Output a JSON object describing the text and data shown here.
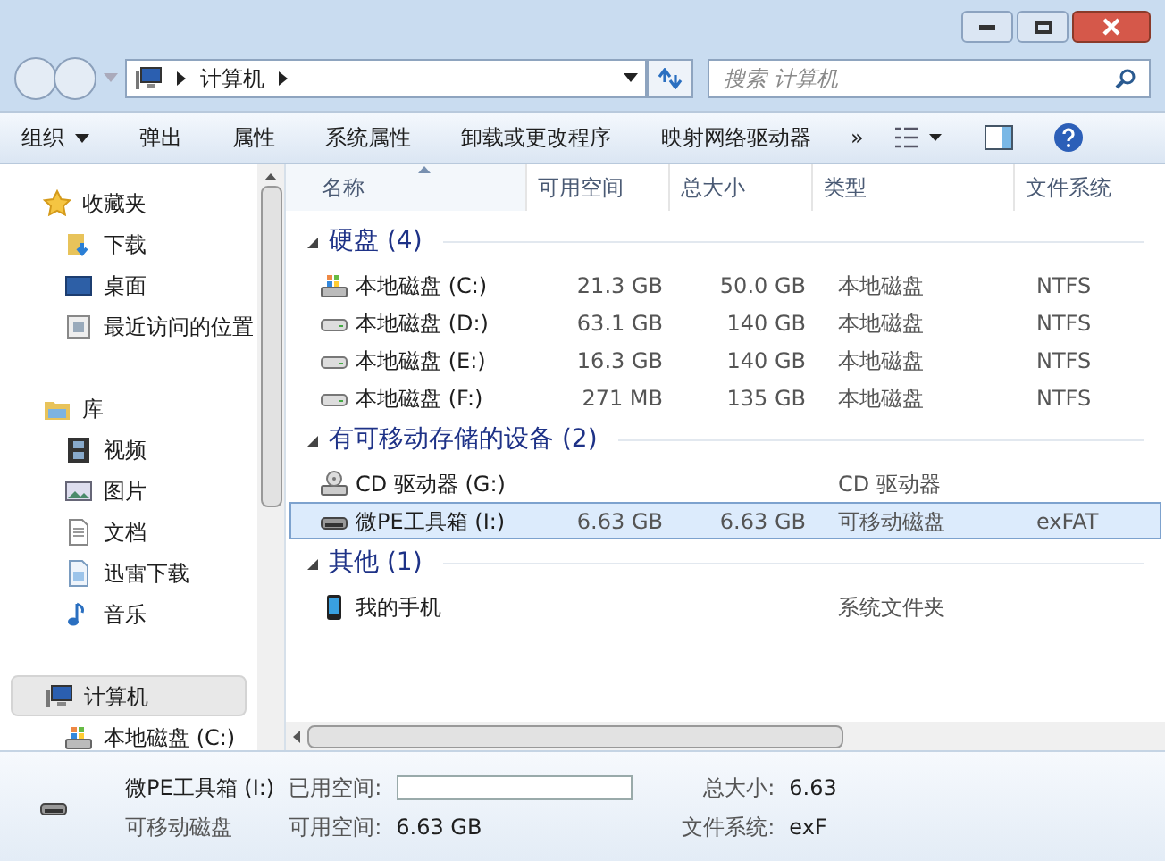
{
  "address_bar": {
    "path": [
      "计算机"
    ]
  },
  "search": {
    "placeholder": "搜索 计算机"
  },
  "toolbar": {
    "items": [
      {
        "label": "组织",
        "dropdown": true
      },
      {
        "label": "弹出",
        "dropdown": false
      },
      {
        "label": "属性",
        "dropdown": false
      },
      {
        "label": "系统属性",
        "dropdown": false
      },
      {
        "label": "卸载或更改程序",
        "dropdown": false
      },
      {
        "label": "映射网络驱动器",
        "dropdown": false
      }
    ],
    "overflow": "»"
  },
  "nav": [
    {
      "label": "收藏夹",
      "kind": "star",
      "selected": false,
      "children": [
        {
          "label": "下载",
          "kind": "download",
          "selected": false
        },
        {
          "label": "桌面",
          "kind": "desktop",
          "selected": false
        },
        {
          "label": "最近访问的位置",
          "kind": "recent",
          "selected": false
        }
      ]
    },
    {
      "label": "库",
      "kind": "library",
      "selected": false,
      "children": [
        {
          "label": "视频",
          "kind": "video",
          "selected": false
        },
        {
          "label": "图片",
          "kind": "picture",
          "selected": false
        },
        {
          "label": "文档",
          "kind": "document",
          "selected": false
        },
        {
          "label": "迅雷下载",
          "kind": "document2",
          "selected": false
        },
        {
          "label": "音乐",
          "kind": "music",
          "selected": false
        }
      ]
    },
    {
      "label": "计算机",
      "kind": "computer",
      "selected": true,
      "children": [
        {
          "label": "本地磁盘 (C:)",
          "kind": "sysdrive",
          "selected": false
        }
      ]
    }
  ],
  "columns": [
    {
      "label": "名称",
      "sorted": true
    },
    {
      "label": "可用空间",
      "sorted": false
    },
    {
      "label": "总大小",
      "sorted": false
    },
    {
      "label": "类型",
      "sorted": false
    },
    {
      "label": "文件系统",
      "sorted": false
    }
  ],
  "groups": [
    {
      "title": "硬盘 (4)",
      "expanded": true,
      "items": [
        {
          "name": "本地磁盘 (C:)",
          "kind": "sysdrive",
          "free": "21.3 GB",
          "total": "50.0 GB",
          "type": "本地磁盘",
          "fs": "NTFS",
          "selected": false
        },
        {
          "name": "本地磁盘 (D:)",
          "kind": "drive",
          "free": "63.1 GB",
          "total": "140 GB",
          "type": "本地磁盘",
          "fs": "NTFS",
          "selected": false
        },
        {
          "name": "本地磁盘 (E:)",
          "kind": "drive",
          "free": "16.3 GB",
          "total": "140 GB",
          "type": "本地磁盘",
          "fs": "NTFS",
          "selected": false
        },
        {
          "name": "本地磁盘 (F:)",
          "kind": "drive",
          "free": "271 MB",
          "total": "135 GB",
          "type": "本地磁盘",
          "fs": "NTFS",
          "selected": false
        }
      ]
    },
    {
      "title": "有可移动存储的设备 (2)",
      "expanded": true,
      "items": [
        {
          "name": "CD 驱动器 (G:)",
          "kind": "cd",
          "type": "CD 驱动器",
          "selected": false
        },
        {
          "name": "微PE工具箱 (I:)",
          "kind": "usb",
          "free": "6.63 GB",
          "total": "6.63 GB",
          "type": "可移动磁盘",
          "fs": "exFAT",
          "selected": true
        }
      ]
    },
    {
      "title": "其他 (1)",
      "expanded": true,
      "items": [
        {
          "name": "我的手机",
          "kind": "phone",
          "type": "系统文件夹",
          "selected": false
        }
      ]
    }
  ],
  "details": {
    "name": "微PE工具箱 (I:)",
    "type": "可移动磁盘",
    "used_label": "已用空间:",
    "used_bar": {
      "level": 0
    },
    "free_label": "可用空间:",
    "free": "6.63 GB",
    "total_label": "总大小:",
    "total": "6.63",
    "fs_label": "文件系统:",
    "fs": "exF"
  }
}
